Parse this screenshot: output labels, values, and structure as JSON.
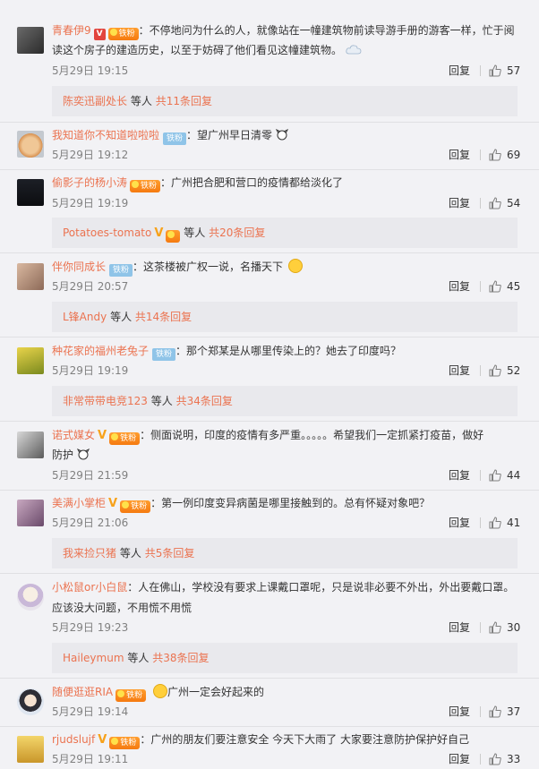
{
  "top_text": "[unclear]",
  "comments": [
    {
      "user": "青春伊9",
      "badges": [
        "v-red",
        "fan"
      ],
      "text": "：不停地问为什么的人，就像站在一幢建筑物前读导游手册的游客一样，忙于阅读这个房子的建造历史，以至于妨碍了他们看见这幢建筑物。",
      "time": "5月29日 19:15",
      "reply": "回复",
      "likes": "57",
      "sub": {
        "names": "陈奕迅副处长",
        "mid": "等人",
        "total": "共11条回复"
      }
    },
    {
      "user": "我知道你不知道啦啦啦",
      "badges": [
        "tie"
      ],
      "text": "：望广州早日清零",
      "time": "5月29日 19:12",
      "reply": "回复",
      "likes": "69"
    },
    {
      "user": "偷影子的杨小涛",
      "badges": [
        "fan"
      ],
      "text": "：广州把合肥和营口的疫情都给淡化了",
      "time": "5月29日 19:19",
      "reply": "回复",
      "likes": "54",
      "sub": {
        "names": "Potatoes-tomato",
        "mid": "等人",
        "total": "共20条回复"
      }
    },
    {
      "user": "伴你同成长",
      "badges": [
        "tie"
      ],
      "text": "：这茶楼被广权一说，名播天下",
      "time": "5月29日 20:57",
      "reply": "回复",
      "likes": "45",
      "sub": {
        "names": "L锋Andy",
        "mid": "等人",
        "total": "共14条回复"
      }
    },
    {
      "user": "种花家的福州老兔子",
      "badges": [
        "tie"
      ],
      "text": "：那个郑某是从哪里传染上的？她去了印度吗？",
      "time": "5月29日 19:19",
      "reply": "回复",
      "likes": "52",
      "sub": {
        "names": "非常带带电竞123",
        "mid": "等人",
        "total": "共34条回复"
      }
    },
    {
      "user": "诺式媒女",
      "badges": [
        "v",
        "fan"
      ],
      "text": "：侧面说明，印度的疫情有多严重。。。。。希望我们一定抓紧打疫苗，做好",
      "text2": "防护",
      "time": "5月29日 21:59",
      "reply": "回复",
      "likes": "44"
    },
    {
      "user": "美满小掌柜",
      "badges": [
        "v",
        "fan"
      ],
      "text": "：第一例印度变异病菌是哪里接触到的。总有怀疑对象吧？",
      "time": "5月29日 21:06",
      "reply": "回复",
      "likes": "41",
      "sub": {
        "names": "我来捡只猪",
        "mid": "等人",
        "total": "共5条回复"
      }
    },
    {
      "user": "小松鼠or小白鼠",
      "badges": [],
      "text": "：人在佛山，学校没有要求上课戴口罩呢，只是说非必要不外出，外出要戴口罩。",
      "text2": "应该没大问题，不用慌不用慌",
      "time": "5月29日 19:23",
      "reply": "回复",
      "likes": "30",
      "sub": {
        "names": "Haileymum",
        "mid": "等人",
        "total": "共38条回复"
      }
    },
    {
      "user": "随便逛逛RIA",
      "badges": [
        "fan"
      ],
      "text": "广州一定会好起来的",
      "time": "5月29日 19:14",
      "reply": "回复",
      "likes": "37"
    },
    {
      "user": "rjudslujf",
      "badges": [
        "v",
        "fan"
      ],
      "text": "：广州的朋友们要注意安全 今天下大雨了 大家要注意防护保护好自己",
      "time": "5月29日 19:11",
      "reply": "回复",
      "likes": "33"
    }
  ],
  "badge_labels": {
    "v": "V",
    "fan": "铁粉",
    "tie": "铁粉"
  },
  "colors": {
    "accent": "#eb7350",
    "link": "#eb7350",
    "badge_v": "#f7a21b",
    "badge_tie": "#8fc4e8"
  }
}
